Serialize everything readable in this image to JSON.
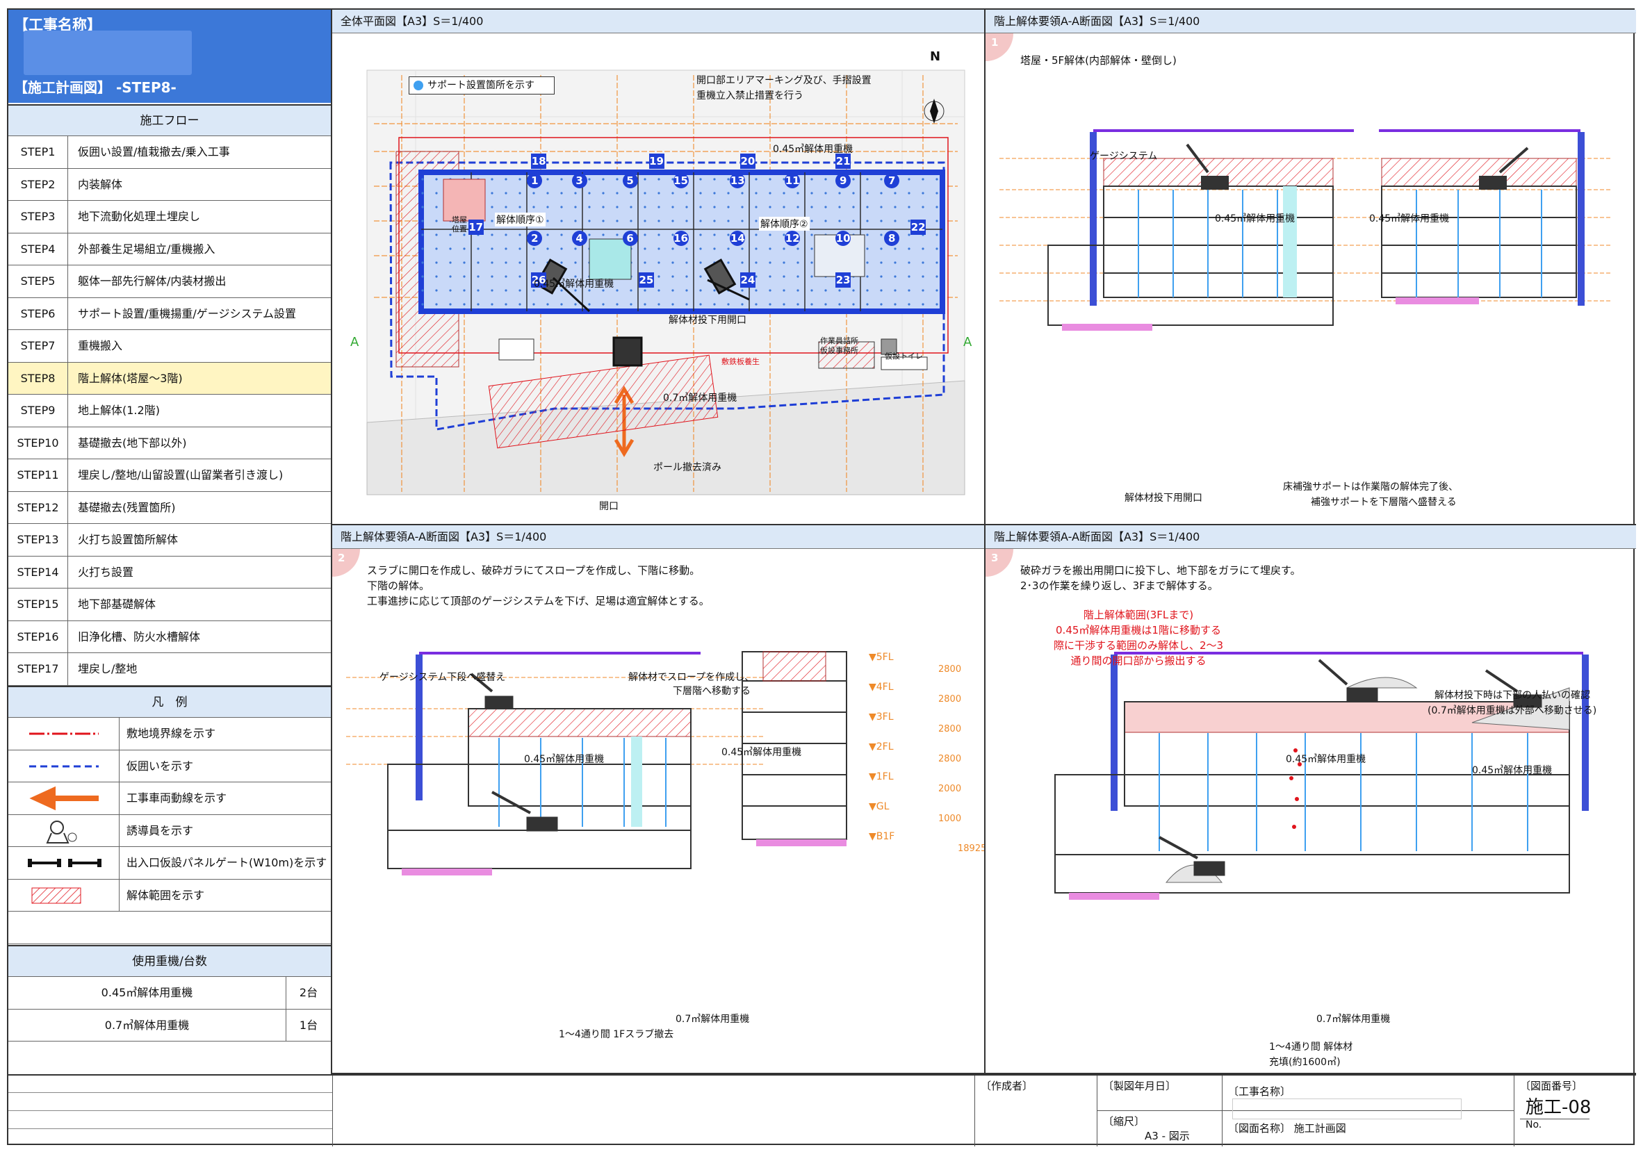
{
  "title": {
    "project_label": "【工事名称】",
    "plan_label": "【施工計画図】",
    "step_label": "-STEP8-"
  },
  "flow": {
    "heading": "施工フロー",
    "steps": [
      {
        "id": "STEP1",
        "text": "仮囲い設置/植栽撤去/乗入工事"
      },
      {
        "id": "STEP2",
        "text": "内装解体"
      },
      {
        "id": "STEP3",
        "text": "地下流動化処理土埋戻し"
      },
      {
        "id": "STEP4",
        "text": "外部養生足場組立/重機搬入"
      },
      {
        "id": "STEP5",
        "text": "躯体一部先行解体/内装材搬出"
      },
      {
        "id": "STEP6",
        "text": "サポート設置/重機揚重/ゲージシステム設置"
      },
      {
        "id": "STEP7",
        "text": "重機搬入"
      },
      {
        "id": "STEP8",
        "text": "階上解体(塔屋～3階)"
      },
      {
        "id": "STEP9",
        "text": "地上解体(1.2階)"
      },
      {
        "id": "STEP10",
        "text": "基礎撤去(地下部以外)"
      },
      {
        "id": "STEP11",
        "text": "埋戻し/整地/山留設置(山留業者引き渡し)"
      },
      {
        "id": "STEP12",
        "text": "基礎撤去(残置箇所)"
      },
      {
        "id": "STEP13",
        "text": "火打ち設置箇所解体"
      },
      {
        "id": "STEP14",
        "text": "火打ち設置"
      },
      {
        "id": "STEP15",
        "text": "地下部基礎解体"
      },
      {
        "id": "STEP16",
        "text": "旧浄化槽、防火水槽解体"
      },
      {
        "id": "STEP17",
        "text": "埋戻し/整地"
      }
    ],
    "current": "STEP8"
  },
  "legend": {
    "heading": "凡　例",
    "items": [
      {
        "icon": "boundary-line",
        "text": "敷地境界線を示す",
        "color": "#e0141c"
      },
      {
        "icon": "temporary-fence-line",
        "text": "仮囲いを示す",
        "color": "#1f3fd6"
      },
      {
        "icon": "arrow-left-icon",
        "text": "工事車両動線を示す",
        "color": "#ee6a1f"
      },
      {
        "icon": "guide-person-icon",
        "text": "誘導員を示す"
      },
      {
        "icon": "panel-gate-icon",
        "text": "出入口仮設パネルゲート(W10m)を示す"
      },
      {
        "icon": "hatch-icon",
        "text": "解体範囲を示す",
        "color": "#e0141c"
      }
    ]
  },
  "equipment": {
    "heading": "使用重機/台数",
    "items": [
      {
        "name": "0.45㎥解体用重機",
        "count": "2台"
      },
      {
        "name": "0.7㎥解体用重機",
        "count": "1台"
      }
    ]
  },
  "panels": {
    "plan": {
      "title": "全体平面図【A3】S＝1/400",
      "support_note": "サポート設置箇所を示す",
      "callout1": "開口部エリアマーキング及び、手摺設置",
      "callout2": "重機立入禁止措置を行う",
      "excavator_045_a": "0.45㎥解体用重機",
      "excavator_045_b": "0.45㎥解体用重機",
      "excavator_07": "0.7㎥解体用重機",
      "opening_label": "解体材投下用開口",
      "order1": "解体順序①",
      "order2": "解体順序②",
      "pole_removed": "ポール撤去済み",
      "opening": "開口",
      "office": "作業員詰所\n仮設事務所",
      "toilet": "仮設トイレ",
      "tower": "塔屋\n位置",
      "steel_plate": "敷鉄板養生",
      "north": "N",
      "section_mark": "A",
      "numbers": [
        "1",
        "2",
        "3",
        "4",
        "5",
        "6",
        "7",
        "8",
        "9",
        "10",
        "11",
        "12",
        "13",
        "14",
        "15",
        "16",
        "17",
        "18",
        "19",
        "20",
        "21",
        "22",
        "23",
        "24",
        "25",
        "26"
      ]
    },
    "p1": {
      "title": "階上解体要領A-A断面図【A3】S＝1/400",
      "num": "1",
      "desc": "塔屋・5F解体(内部解体・壁倒し)",
      "gauge": "ゲージシステム",
      "exc_a": "0.45㎥解体用重機",
      "exc_b": "0.45㎥解体用重機",
      "opening": "解体材投下用開口",
      "support1": "床補強サポートは作業階の解体完了後、",
      "support2": "補強サポートを下層階へ盛替える"
    },
    "p2": {
      "title": "階上解体要領A-A断面図【A3】S＝1/400",
      "num": "2",
      "desc1": "スラブに開口を作成し、破砕ガラにてスロープを作成し、下階に移動。",
      "desc2": "下階の解体。",
      "desc3": "工事進捗に応じて頂部のゲージシステムを下げ、足場は適宜解体とする。",
      "gauge": "ゲージシステム下段へ盛替え",
      "slope1": "解体材でスロープを作成し、",
      "slope2": "下層階へ移動する",
      "exc_a": "0.45㎥解体用重機",
      "exc_b": "0.45㎥解体用重機",
      "exc_c": "0.7㎥解体用重機",
      "slab": "1～4通り間 1Fスラブ撤去",
      "levels": [
        "▼5FL",
        "▼4FL",
        "▼3FL",
        "▼2FL",
        "▼1FL",
        "▼GL",
        "▼B1F"
      ],
      "dims": [
        "2800",
        "2800",
        "2800",
        "2800",
        "2000",
        "1000",
        "18925"
      ]
    },
    "p3": {
      "title": "階上解体要領A-A断面図【A3】S＝1/400",
      "num": "3",
      "desc1": "破砕ガラを搬出用開口に投下し、地下部をガラにて埋戻す。",
      "desc2": "2･3の作業を繰り返し、3Fまで解体する。",
      "red1": "階上解体範囲(3FLまで)",
      "red2": "0.45㎥解体用重機は1階に移動する",
      "red3": "際に干渉する範囲のみ解体し、2～3",
      "red4": "通り間の開口部から搬出する",
      "check1": "解体材投下時は下部の人払いの確認",
      "check2": "(0.7㎥解体用重機は外部へ移動させる)",
      "exc_a": "0.45㎥解体用重機",
      "exc_b": "0.45㎥解体用重機",
      "exc_c": "0.7㎥解体用重機",
      "fill1": "1～4通り間 解体材",
      "fill2": "充填(約1600㎥)"
    }
  },
  "titleblock": {
    "author": "〔作成者〕",
    "date": "〔製図年月日〕",
    "scale_label": "〔縮尺〕",
    "scale": "A3 - 図示",
    "project": "〔工事名称〕",
    "drawing_name_label": "〔図面名称〕",
    "drawing_name": "施工計画図",
    "drawing_no_label": "〔図面番号〕",
    "drawing_no": "施工-08",
    "no": "No."
  },
  "colors": {
    "accent_blue": "#3c78d8",
    "header_blue": "#dbe8f7",
    "highlight": "#fff5c2",
    "red": "#e0141c",
    "orange": "#ee8a2a"
  }
}
